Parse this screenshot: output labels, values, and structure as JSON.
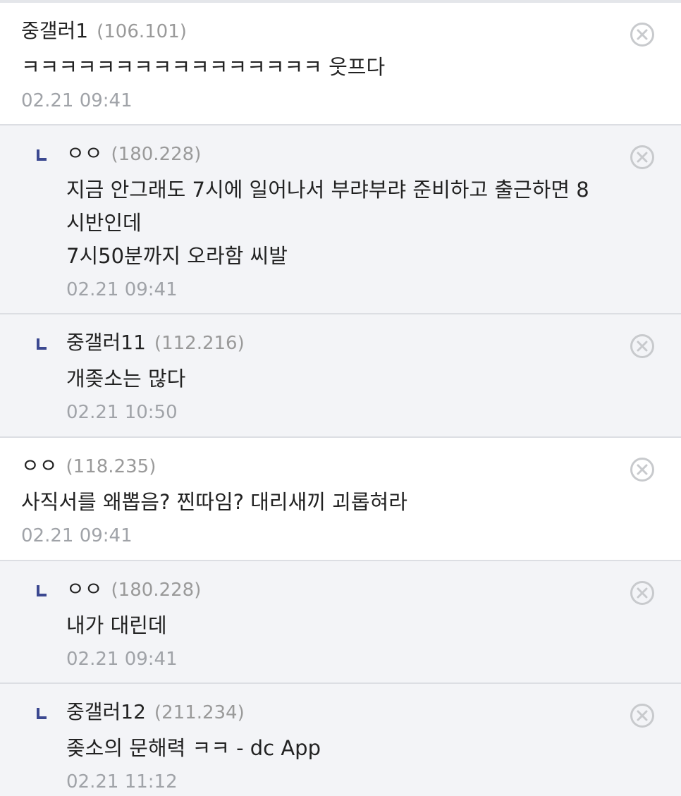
{
  "comments": [
    {
      "nick": "중갤러1",
      "ip": "(106.101)",
      "lines": [
        "ㅋㅋㅋㅋㅋㅋㅋㅋㅋㅋㅋㅋㅋㅋㅋㅋ 웃프다"
      ],
      "date": "02.21 09:41",
      "reply": false
    },
    {
      "nick": "ㅇㅇ",
      "ip": "(180.228)",
      "lines": [
        "지금 안그래도 7시에 일어나서 부랴부랴 준비하고 출근하면 8시반인데",
        "7시50분까지 오라함 씨발"
      ],
      "date": "02.21 09:41",
      "reply": true
    },
    {
      "nick": "중갤러11",
      "ip": "(112.216)",
      "lines": [
        "개좆소는 많다"
      ],
      "date": "02.21 10:50",
      "reply": true
    },
    {
      "nick": "ㅇㅇ",
      "ip": "(118.235)",
      "lines": [
        "사직서를 왜뽑음? 찐따임? 대리새끼 괴롭혀라"
      ],
      "date": "02.21 09:41",
      "reply": false
    },
    {
      "nick": "ㅇㅇ",
      "ip": "(180.228)",
      "lines": [
        "내가 대린데"
      ],
      "date": "02.21 09:41",
      "reply": true
    },
    {
      "nick": "중갤러12",
      "ip": "(211.234)",
      "lines": [
        "좆소의 문해력 ㅋㅋ - dc App"
      ],
      "date": "02.21 11:12",
      "reply": true
    }
  ],
  "icons": {
    "reply_marker": "reply-arrow-icon",
    "delete": "close-circle-icon"
  },
  "colors": {
    "reply_marker": "#3b4890",
    "reply_background": "#f3f4f7",
    "meta_text": "#9a9a9a"
  }
}
